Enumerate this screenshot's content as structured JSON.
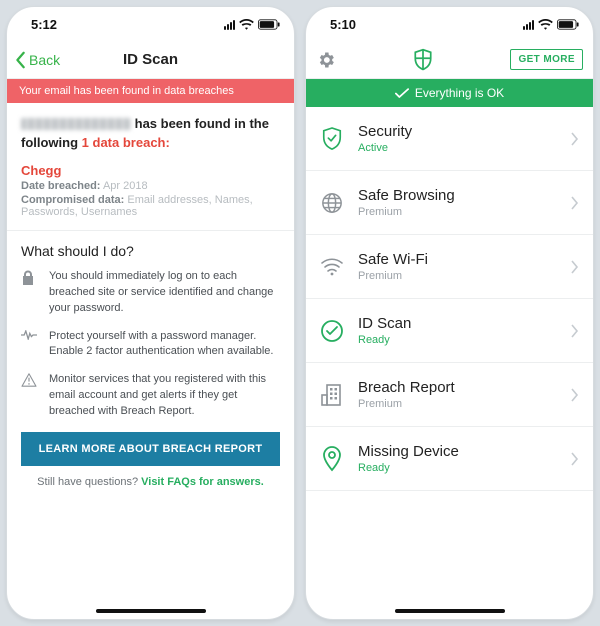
{
  "phoneA": {
    "status": {
      "time": "5:12"
    },
    "nav": {
      "back_label": "Back",
      "title": "ID Scan"
    },
    "alert_text": "Your email has been found in data breaches",
    "found_line_tail": "has been found in the following",
    "breach_count_text": "1 data breach:",
    "breach": {
      "name": "Chegg",
      "date_label": "Date breached:",
      "date_value": "Apr 2018",
      "compromised_label": "Compromised data:",
      "compromised_value": "Email addresses, Names, Passwords, Usernames"
    },
    "wsd_title": "What should I do?",
    "tips": [
      {
        "icon": "lock-icon",
        "text": "You should immediately log on to each breached site or service identified and change your password."
      },
      {
        "icon": "pulse-icon",
        "text": "Protect yourself with a password manager. Enable 2 factor authentication when available."
      },
      {
        "icon": "warning-icon",
        "text": "Monitor services that you registered with this email account and get alerts if they get breached with Breach Report."
      }
    ],
    "cta_label": "LEARN MORE ABOUT BREACH REPORT",
    "faqs_prefix": "Still have questions? ",
    "faqs_link": "Visit FAQs for answers."
  },
  "phoneB": {
    "status": {
      "time": "5:10"
    },
    "nav": {
      "get_more_label": "GET MORE"
    },
    "ok_text": "Everything is OK",
    "items": [
      {
        "icon": "shield-outline-icon",
        "title": "Security",
        "status": "Active",
        "status_kind": "green",
        "icon_green": true
      },
      {
        "icon": "globe-icon",
        "title": "Safe Browsing",
        "status": "Premium",
        "status_kind": "grey",
        "icon_green": false
      },
      {
        "icon": "wifi-icon",
        "title": "Safe Wi-Fi",
        "status": "Premium",
        "status_kind": "grey",
        "icon_green": false
      },
      {
        "icon": "check-circle-icon",
        "title": "ID Scan",
        "status": "Ready",
        "status_kind": "green",
        "icon_green": true
      },
      {
        "icon": "building-icon",
        "title": "Breach Report",
        "status": "Premium",
        "status_kind": "grey",
        "icon_green": false
      },
      {
        "icon": "location-pin-icon",
        "title": "Missing Device",
        "status": "Ready",
        "status_kind": "green",
        "icon_green": true
      }
    ]
  }
}
